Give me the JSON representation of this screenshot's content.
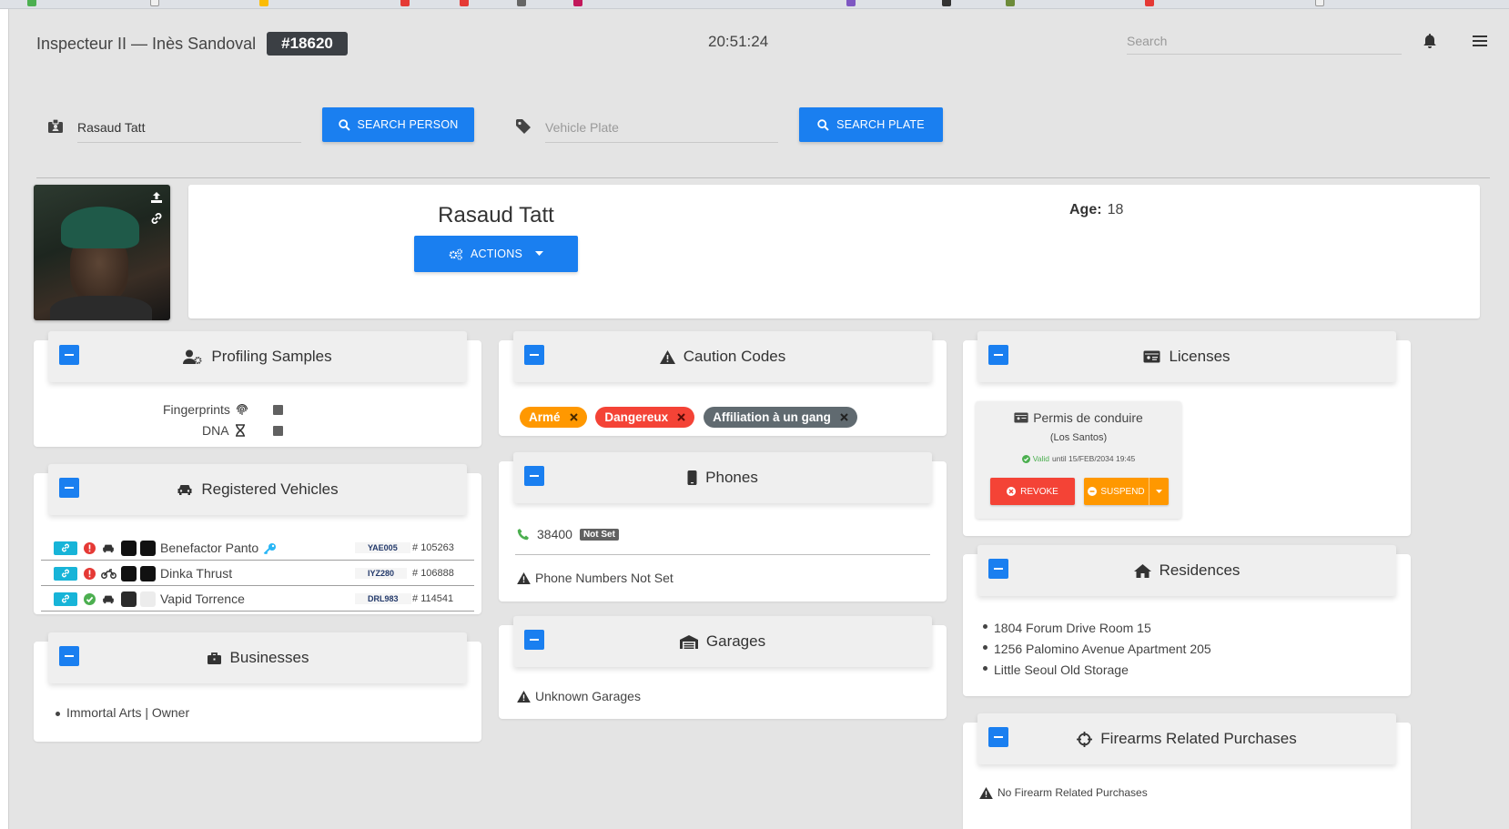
{
  "header": {
    "title": "Inspecteur II — Inès Sandoval",
    "badge": "#18620",
    "clock": "20:51:24",
    "search_placeholder": "Search"
  },
  "search": {
    "person_value": "Rasaud Tatt",
    "person_button": "SEARCH PERSON",
    "plate_placeholder": "Vehicle Plate",
    "plate_button": "SEARCH PLATE"
  },
  "profile": {
    "name": "Rasaud Tatt",
    "actions_label": "ACTIONS",
    "age_label": "Age:",
    "age_value": "18"
  },
  "profiling": {
    "title": "Profiling Samples",
    "items": [
      {
        "label": "Fingerprints",
        "icon": "fingerprint-icon"
      },
      {
        "label": "DNA",
        "icon": "dna-icon"
      }
    ]
  },
  "vehicles": {
    "title": "Registered Vehicles",
    "rows": [
      {
        "name": "Benefactor Panto",
        "plate": "YAE005",
        "number": "105263",
        "status": "alert",
        "type": "car-icon",
        "color1": "#111111",
        "color2": "#111111",
        "has_key": true
      },
      {
        "name": "Dinka Thrust",
        "plate": "IYZ280",
        "number": "106888",
        "status": "alert",
        "type": "motorcycle-icon",
        "color1": "#111111",
        "color2": "#111111",
        "has_key": false
      },
      {
        "name": "Vapid Torrence",
        "plate": "DRL983",
        "number": "114541",
        "status": "ok",
        "type": "car-icon",
        "color1": "#2b2b2b",
        "color2": "#ececec",
        "has_key": false
      }
    ]
  },
  "businesses": {
    "title": "Businesses",
    "items": [
      "Immortal Arts | Owner"
    ]
  },
  "caution": {
    "title": "Caution Codes",
    "codes": [
      {
        "label": "Armé",
        "color": "#ff9800"
      },
      {
        "label": "Dangereux",
        "color": "#f44336"
      },
      {
        "label": "Affiliation à un gang",
        "color": "#606a70"
      }
    ]
  },
  "phones": {
    "title": "Phones",
    "number": "38400",
    "number_badge": "Not Set",
    "warning": "Phone Numbers Not Set"
  },
  "garages": {
    "title": "Garages",
    "warning": "Unknown Garages"
  },
  "licenses": {
    "title": "Licenses",
    "card_title": "Permis de conduire",
    "card_region": "(Los Santos)",
    "valid_word": "Valid",
    "valid_until": "until 15/FEB/2034 19:45",
    "revoke": "REVOKE",
    "suspend": "SUSPEND"
  },
  "residences": {
    "title": "Residences",
    "items": [
      "1804 Forum Drive Room 15",
      "1256 Palomino Avenue Apartment 205",
      "Little Seoul Old Storage"
    ]
  },
  "firearms": {
    "title": "Firearms Related Purchases",
    "warning": "No Firearm Related Purchases"
  },
  "colors": {
    "primary": "#1a7ff0",
    "danger": "#f44336",
    "warning": "#ff9800",
    "info": "#17b4d8",
    "success": "#4caf50",
    "dark": "#3b3f44"
  }
}
